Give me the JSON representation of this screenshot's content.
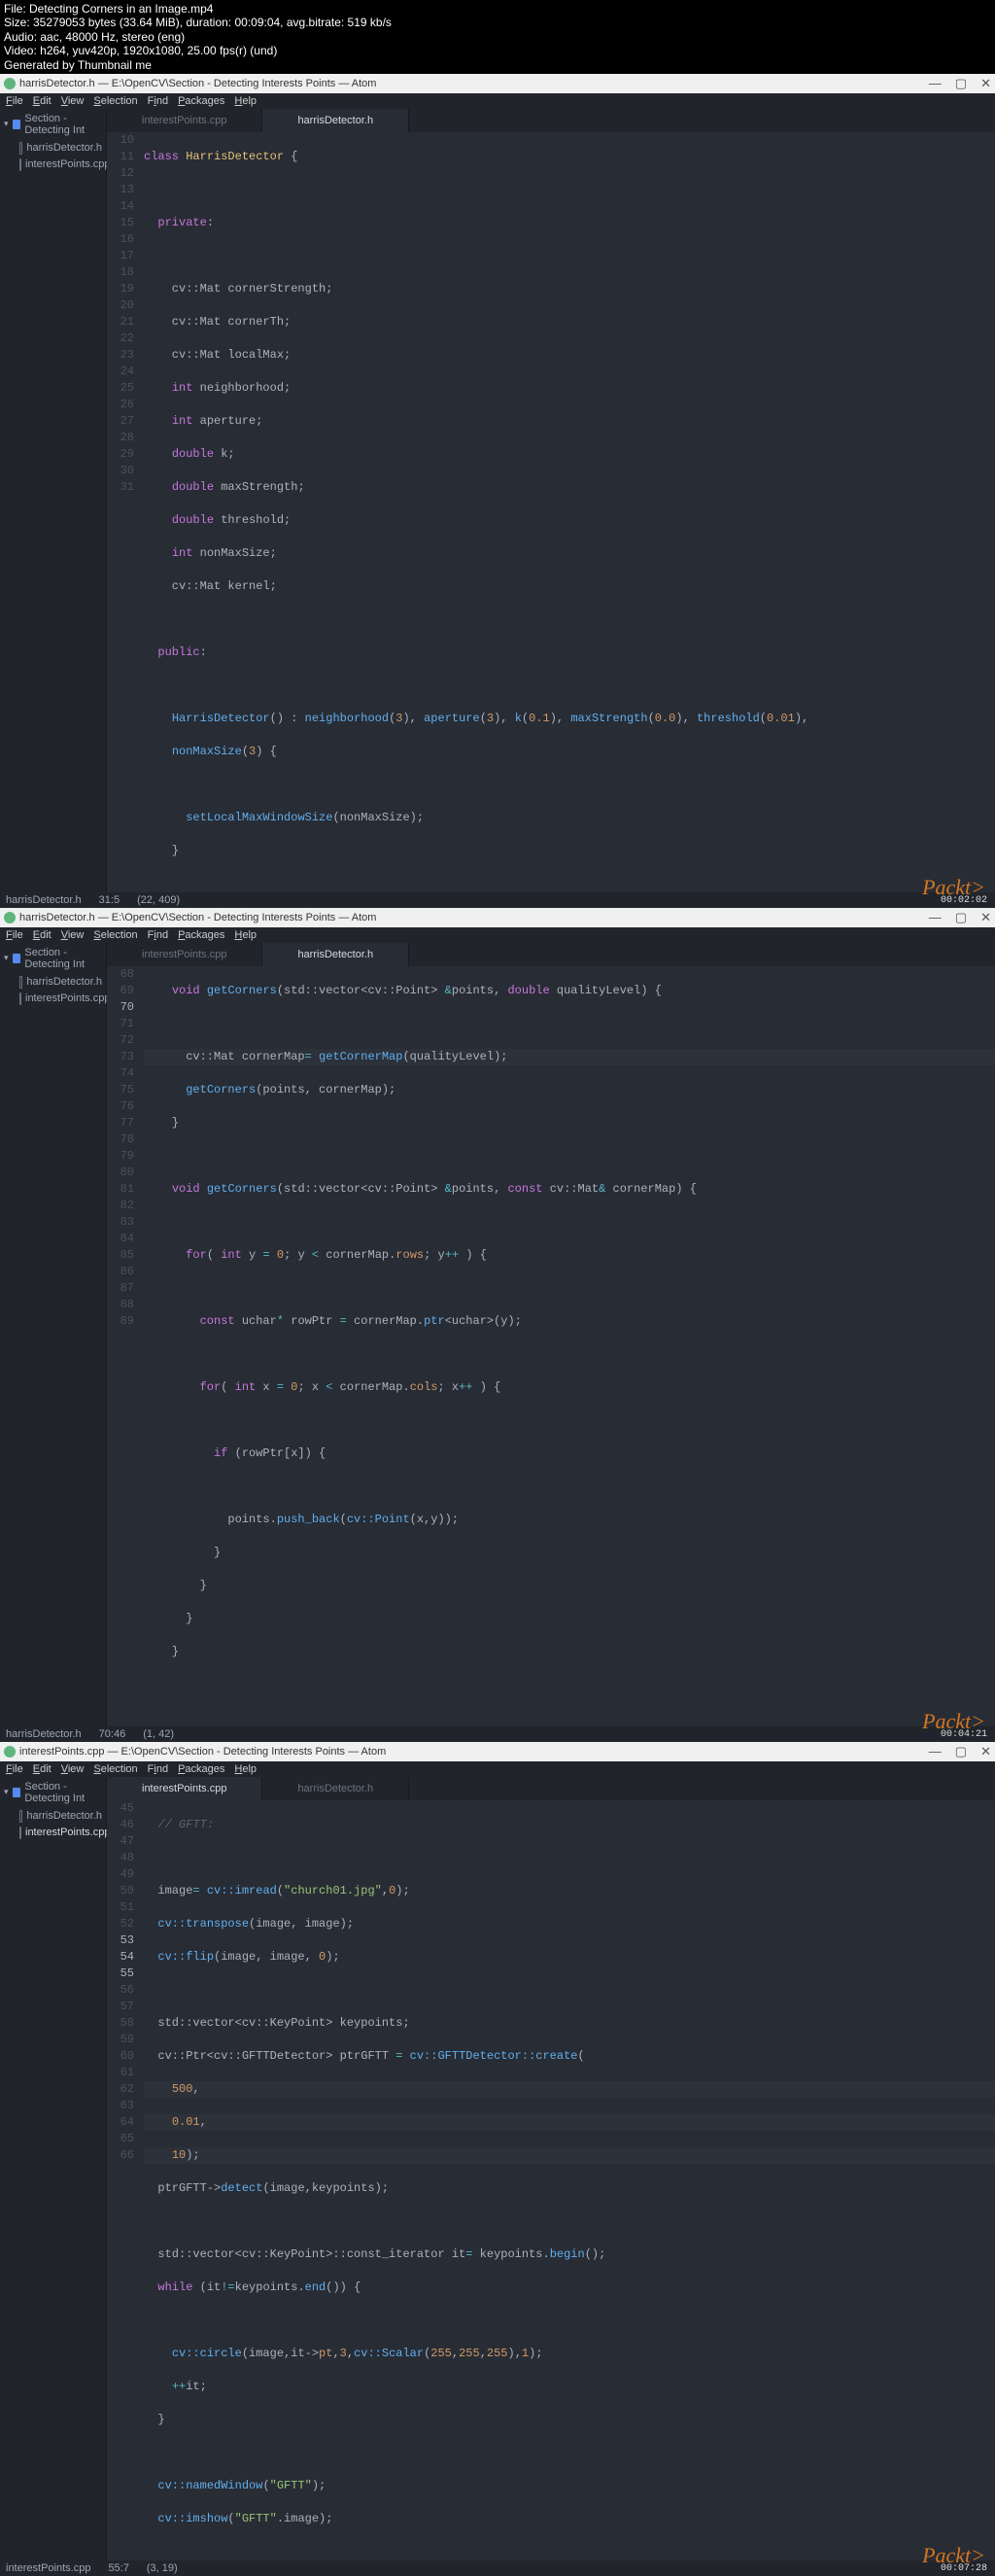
{
  "header": {
    "file": "File: Detecting Corners in an Image.mp4",
    "size": "Size: 35279053 bytes (33.64 MiB), duration: 00:09:04, avg.bitrate: 519 kb/s",
    "audio": "Audio: aac, 48000 Hz, stereo (eng)",
    "video": "Video: h264, yuv420p, 1920x1080, 25.00 fps(r) (und)",
    "gen": "Generated by Thumbnail me"
  },
  "menu": {
    "file": "File",
    "edit": "Edit",
    "view": "View",
    "selection": "Selection",
    "find": "Find",
    "packages": "Packages",
    "help": "Help"
  },
  "tree": {
    "root": "Section - Detecting Int",
    "f1": "harrisDetector.h",
    "f2": "interestPoints.cpp"
  },
  "win1": {
    "title": "harrisDetector.h — E:\\OpenCV\\Section - Detecting Interests Points — Atom",
    "tabs": {
      "t1": "interestPoints.cpp",
      "t2": "harrisDetector.h"
    },
    "lines": {
      "start": 10,
      "count": 22,
      "l10": "class HarrisDetector {",
      "l11": "",
      "l12": "  private:",
      "l13": "",
      "l14": "    cv::Mat cornerStrength;",
      "l15": "    cv::Mat cornerTh;",
      "l16": "    cv::Mat localMax;",
      "l17": "    int neighborhood;",
      "l18": "    int aperture;",
      "l19": "    double k;",
      "l20": "    double maxStrength;",
      "l21": "    double threshold;",
      "l22": "    int nonMaxSize;",
      "l23": "    cv::Mat kernel;",
      "l24": "",
      "l25": "  public:",
      "l26": "",
      "l27": "    HarrisDetector() : neighborhood(3), aperture(3), k(0.1), maxStrength(0.0), threshold(0.01),",
      "l28": "    nonMaxSize(3) {",
      "l29": "",
      "l30": "      setLocalMaxWindowSize(nonMaxSize);",
      "l31": "    }"
    },
    "status": {
      "path": "harrisDetector.h",
      "pos": "31:5",
      "sel": "(22, 409)"
    },
    "ts": "00:02:02"
  },
  "win2": {
    "title": "harrisDetector.h — E:\\OpenCV\\Section - Detecting Interests Points — Atom",
    "tabs": {
      "t1": "interestPoints.cpp",
      "t2": "harrisDetector.h"
    },
    "lines": {
      "start": 68,
      "count": 22,
      "l68": "    void getCorners(std::vector<cv::Point> &points, double qualityLevel) {",
      "l69": "",
      "l70": "      cv::Mat cornerMap= getCornerMap(qualityLevel);",
      "l71": "      getCorners(points, cornerMap);",
      "l72": "    }",
      "l73": "",
      "l74": "    void getCorners(std::vector<cv::Point> &points, const cv::Mat& cornerMap) {",
      "l75": "",
      "l76": "      for( int y = 0; y < cornerMap.rows; y++ ) {",
      "l77": "",
      "l78": "        const uchar* rowPtr = cornerMap.ptr<uchar>(y);",
      "l79": "",
      "l80": "        for( int x = 0; x < cornerMap.cols; x++ ) {",
      "l81": "",
      "l82": "          if (rowPtr[x]) {",
      "l83": "",
      "l84": "            points.push_back(cv::Point(x,y));",
      "l85": "          }",
      "l86": "        }",
      "l87": "      }",
      "l88": "    }",
      "l89": ""
    },
    "status": {
      "path": "harrisDetector.h",
      "pos": "70:46",
      "sel": "(1, 42)"
    },
    "ts": "00:04:21"
  },
  "win3": {
    "title": "interestPoints.cpp — E:\\OpenCV\\Section - Detecting Interests Points — Atom",
    "tabs": {
      "t1": "interestPoints.cpp",
      "t2": "harrisDetector.h"
    },
    "lines": {
      "start": 45,
      "count": 22,
      "l45": "  // GFTT:",
      "l46": "",
      "l47": "  image= cv::imread(\"church01.jpg\",0);",
      "l48": "  cv::transpose(image, image);",
      "l49": "  cv::flip(image, image, 0);",
      "l50": "",
      "l51": "  std::vector<cv::KeyPoint> keypoints;",
      "l52": "  cv::Ptr<cv::GFTTDetector> ptrGFTT = cv::GFTTDetector::create(",
      "l53": "    500,",
      "l54": "    0.01,",
      "l55": "    10);",
      "l56": "  ptrGFTT->detect(image,keypoints);",
      "l57": "",
      "l58": "  std::vector<cv::KeyPoint>::const_iterator it= keypoints.begin();",
      "l59": "  while (it!=keypoints.end()) {",
      "l60": "",
      "l61": "    cv::circle(image,it->pt,3,cv::Scalar(255,255,255),1);",
      "l62": "    ++it;",
      "l63": "  }",
      "l64": "",
      "l65": "  cv::namedWindow(\"GFTT\");",
      "l66": "  cv::imshow(\"GFTT\".image);"
    },
    "status": {
      "path": "interestPoints.cpp",
      "pos": "55:7",
      "sel": "(3, 19)"
    },
    "ts": "00:07:28"
  },
  "watermark": "Packt>",
  "win_min": "—",
  "win_max": "▢",
  "win_close": "✕"
}
